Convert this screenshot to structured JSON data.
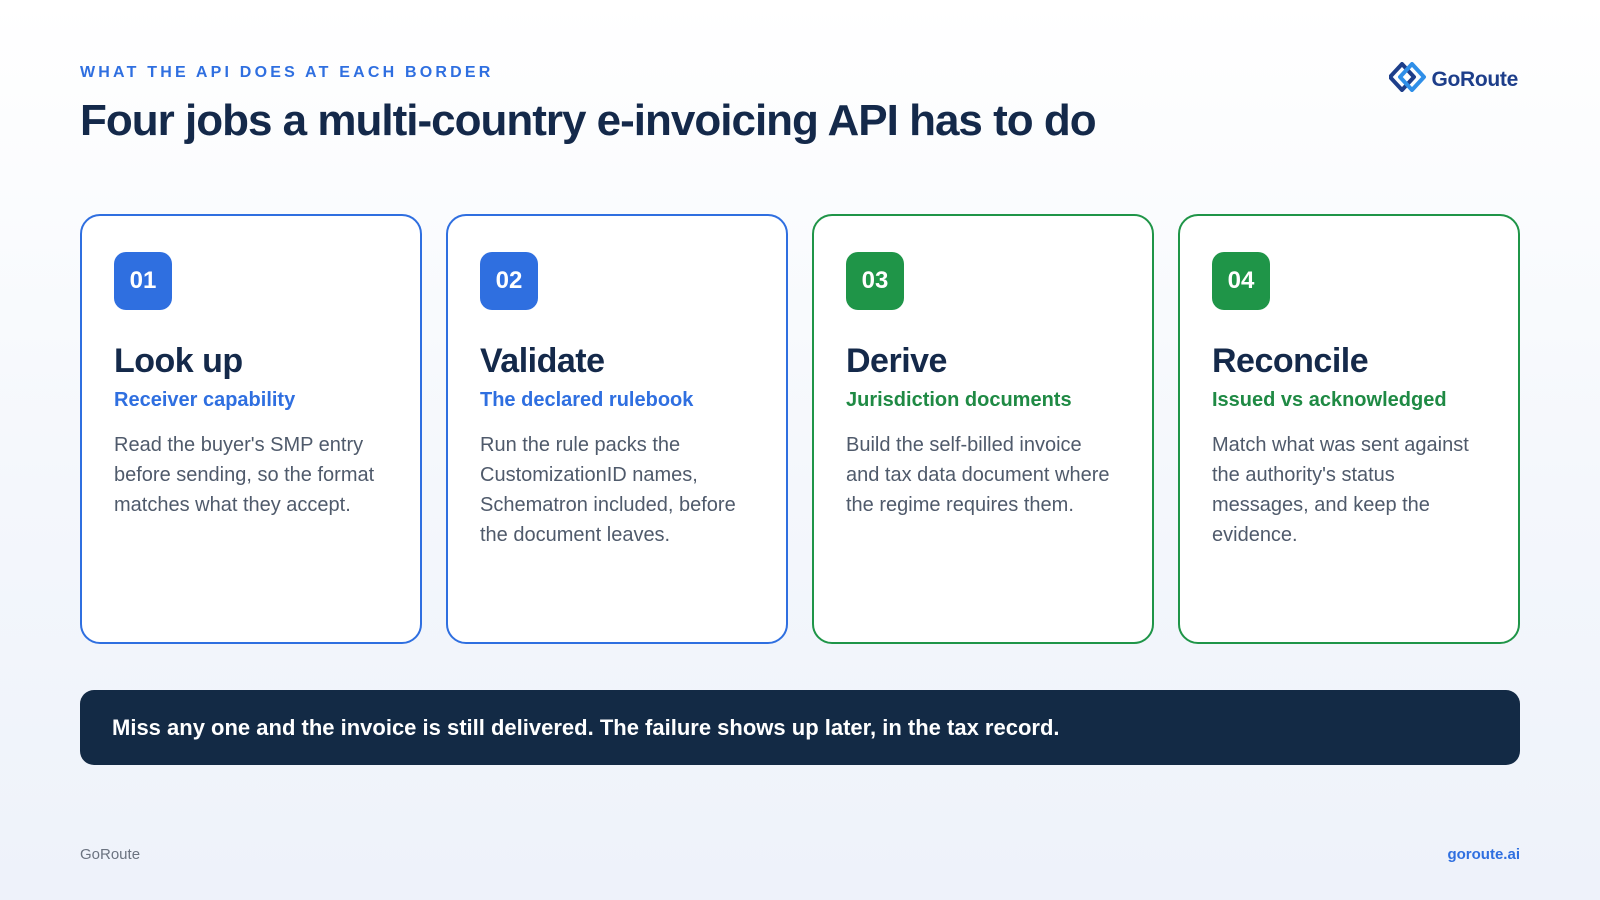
{
  "header": {
    "eyebrow": "WHAT THE API DOES AT EACH BORDER",
    "title": "Four jobs a multi-country e-invoicing API has to do"
  },
  "logo": {
    "text": "GoRoute",
    "icon": "goroute-diamond-logo-icon"
  },
  "cards": [
    {
      "number": "01",
      "title": "Look up",
      "subtitle": "Receiver capability",
      "body": "Read the buyer's SMP entry before sending, so the format matches what they accept.",
      "accent": "#2f6fe0"
    },
    {
      "number": "02",
      "title": "Validate",
      "subtitle": "The declared rulebook",
      "body": "Run the rule packs the CustomizationID names, Schematron included, before the document leaves.",
      "accent": "#2f6fe0"
    },
    {
      "number": "03",
      "title": "Derive",
      "subtitle": "Jurisdiction documents",
      "body": "Build the self-billed invoice and tax data document where the regime requires them.",
      "accent": "#1f9548"
    },
    {
      "number": "04",
      "title": "Reconcile",
      "subtitle": "Issued vs acknowledged",
      "body": "Match what was sent against the authority's status messages, and keep the evidence.",
      "accent": "#1f9548"
    }
  ],
  "callout": {
    "text": "Miss any one and the invoice is still delivered. The failure shows up later, in the tax record."
  },
  "footer": {
    "left": "GoRoute",
    "right": "goroute.ai"
  },
  "colors": {
    "blue": "#2f6fe0",
    "green": "#1f9548",
    "navy": "#132a45"
  }
}
